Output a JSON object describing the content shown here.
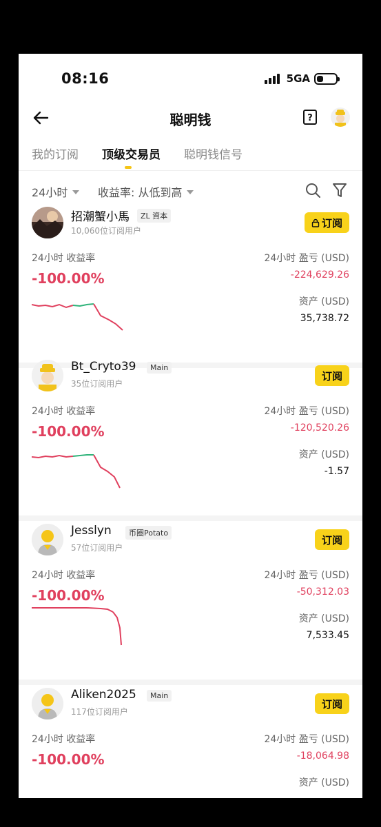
{
  "status": {
    "time": "08:16",
    "network": "5GA"
  },
  "nav": {
    "title": "聪明钱"
  },
  "tabs": [
    "我的订阅",
    "顶级交易员",
    "聪明钱信号"
  ],
  "filters": {
    "period": "24小时",
    "sort": "收益率: 从低到高"
  },
  "labels": {
    "roi_label": "24小时 收益率",
    "pnl_label": "24小时 盈亏 (USD)",
    "asset_label": "资产 (USD)"
  },
  "traders": [
    {
      "name": "招潮蟹小馬",
      "tag": "ZL 資本",
      "subscribers": "10,060位订阅用户",
      "button": "订阅",
      "locked": true,
      "roi": "-100.00%",
      "pnl": "-224,629.26",
      "assets": "35,738.72",
      "avatar": "photo-avatar"
    },
    {
      "name": "Bt_Cryto39",
      "tag": "Main",
      "subscribers": "35位订阅用户",
      "button": "订阅",
      "locked": false,
      "roi": "-100.00%",
      "pnl": "-120,520.26",
      "assets": "-1.57",
      "avatar": "hardhat-avatar"
    },
    {
      "name": "Jesslyn",
      "tag": "币圈Potato",
      "subscribers": "57位订阅用户",
      "button": "订阅",
      "locked": false,
      "roi": "-100.00%",
      "pnl": "-50,312.03",
      "assets": "7,533.45",
      "avatar": "default-avatar"
    },
    {
      "name": "Aliken2025",
      "tag": "Main",
      "subscribers": "117位订阅用户",
      "button": "订阅",
      "locked": false,
      "roi": "-100.00%",
      "pnl": "-18,064.98",
      "assets": "",
      "avatar": "default-avatar"
    }
  ],
  "colors": {
    "accent": "#f8d21a",
    "loss": "#e0405e",
    "gain": "#2fb37a"
  }
}
